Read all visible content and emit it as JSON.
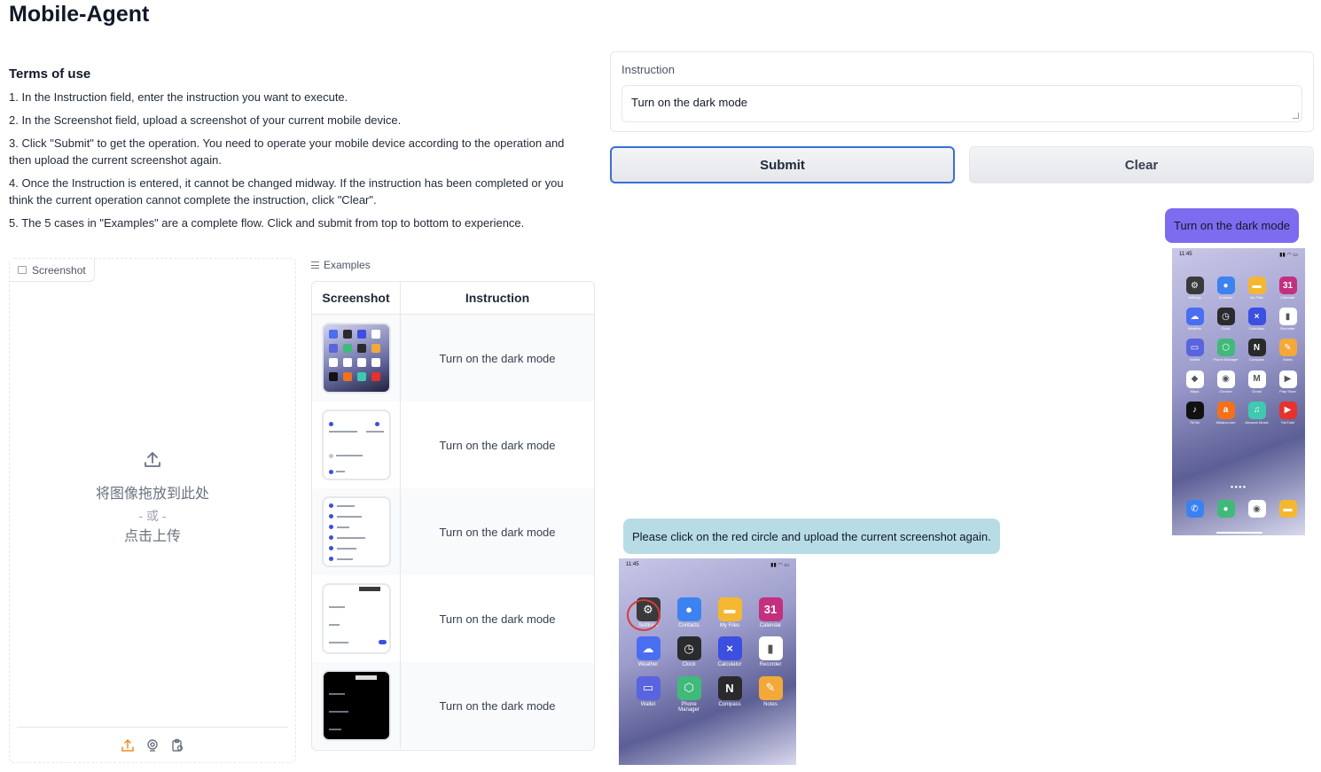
{
  "app": {
    "title": "Mobile-Agent"
  },
  "terms": {
    "heading": "Terms of use",
    "items": [
      "1. In the Instruction field, enter the instruction you want to execute.",
      "2. In the Screenshot field, upload a screenshot of your current mobile device.",
      "3. Click \"Submit\" to get the operation. You need to operate your mobile device according to the operation and then upload the current screenshot again.",
      "4. Once the Instruction is entered, it cannot be changed midway. If the instruction has been completed or you think the current operation cannot complete the instruction, click \"Clear\".",
      "5. The 5 cases in \"Examples\" are a complete flow. Click and submit from top to bottom to experience."
    ]
  },
  "screenshot_upload": {
    "tab_label": "Screenshot",
    "drop_text": "将图像拖放到此处",
    "or_text": "- 或 -",
    "click_text": "点击上传"
  },
  "examples": {
    "label": "Examples",
    "headers": [
      "Screenshot",
      "Instruction"
    ],
    "rows": [
      {
        "instruction": "Turn on the dark mode"
      },
      {
        "instruction": "Turn on the dark mode"
      },
      {
        "instruction": "Turn on the dark mode"
      },
      {
        "instruction": "Turn on the dark mode"
      },
      {
        "instruction": "Turn on the dark mode"
      }
    ]
  },
  "instruction": {
    "label": "Instruction",
    "value": "Turn on the dark mode"
  },
  "buttons": {
    "submit": "Submit",
    "clear": "Clear"
  },
  "chat": {
    "user_message": "Turn on the dark mode",
    "bot_message": "Please click on the red circle and upload the current screenshot again."
  },
  "phone": {
    "time": "11:45",
    "apps": [
      {
        "label": "Settings",
        "color": "#3a3a3c",
        "glyph": "⚙"
      },
      {
        "label": "Contacts",
        "color": "#3c82f0",
        "glyph": "●"
      },
      {
        "label": "My Files",
        "color": "#f5b731",
        "glyph": "▬"
      },
      {
        "label": "Calendar",
        "color": "#c3307e",
        "glyph": "31"
      },
      {
        "label": "Weather",
        "color": "#4a6ef0",
        "glyph": "☁"
      },
      {
        "label": "Clock",
        "color": "#2b2b2e",
        "glyph": "◷"
      },
      {
        "label": "Calculator",
        "color": "#3b4fe0",
        "glyph": "×"
      },
      {
        "label": "Recorder",
        "color": "#ffffff",
        "glyph": "▮"
      },
      {
        "label": "Wallet",
        "color": "#5a63e0",
        "glyph": "▭"
      },
      {
        "label": "Phone Manager",
        "color": "#3fba7a",
        "glyph": "⬡"
      },
      {
        "label": "Compass",
        "color": "#2a2a2d",
        "glyph": "N"
      },
      {
        "label": "Notes",
        "color": "#f3a93a",
        "glyph": "✎"
      },
      {
        "label": "Maps",
        "color": "#ffffff",
        "glyph": "◆"
      },
      {
        "label": "Chrome",
        "color": "#ffffff",
        "glyph": "◉"
      },
      {
        "label": "Gmail",
        "color": "#ffffff",
        "glyph": "M"
      },
      {
        "label": "Play Store",
        "color": "#ffffff",
        "glyph": "▶"
      },
      {
        "label": "TikTok",
        "color": "#111111",
        "glyph": "♪"
      },
      {
        "label": "Alibaba.com",
        "color": "#f2711c",
        "glyph": "a"
      },
      {
        "label": "Amazon Music",
        "color": "#3ec9b0",
        "glyph": "♫"
      },
      {
        "label": "YouTube",
        "color": "#e5322d",
        "glyph": "▶"
      }
    ],
    "dock": [
      {
        "color": "#3b82f0",
        "glyph": "✆"
      },
      {
        "color": "#3fba7a",
        "glyph": "●"
      },
      {
        "color": "#ffffff",
        "glyph": "◉"
      },
      {
        "color": "#f5b731",
        "glyph": "▬"
      }
    ]
  }
}
